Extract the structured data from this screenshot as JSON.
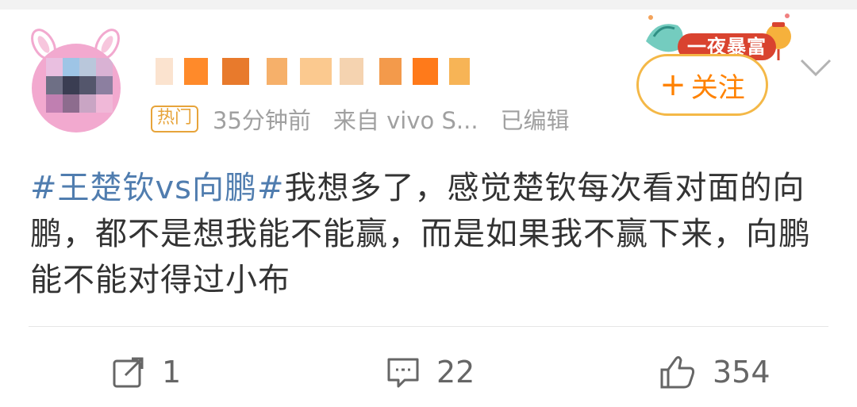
{
  "post": {
    "badge": "热门",
    "time": "35分钟前",
    "source": "来自 vivo S...",
    "edited": "已编辑",
    "topic": "#王楚钦vs向鹏#",
    "text": "我想多了，感觉楚钦每次看对面的向鹏，都不是想我能不能赢，而是如果我不赢下来，向鹏能不能对得过小布"
  },
  "header": {
    "promo_label": "一夜暴富",
    "follow_label": "关注",
    "follow_plus": "+"
  },
  "actions": {
    "share_count": "1",
    "comment_count": "22",
    "like_count": "354"
  },
  "icons": {
    "share": "share-icon",
    "comment": "comment-icon",
    "like": "thumbs-up-icon",
    "chevron": "chevron-down-icon"
  },
  "colors": {
    "topic": "#507daf",
    "follow": "#ff8200",
    "follow_border": "#f4b847",
    "hot_badge": "#e7a43a"
  }
}
